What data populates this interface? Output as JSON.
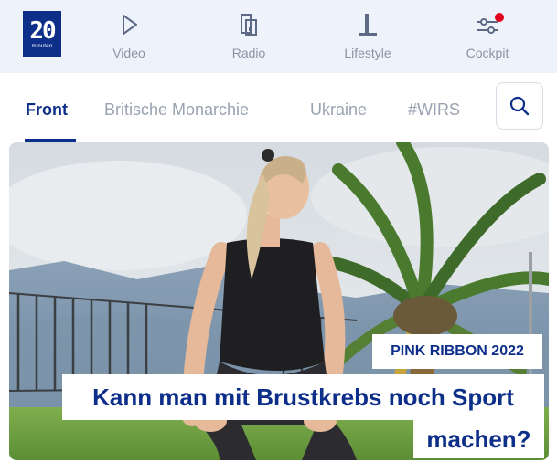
{
  "colors": {
    "brand_blue": "#0d2f8a",
    "topbar_bg": "#eef2fa",
    "muted_text": "#9aa3b2",
    "notification_red": "#e3001b"
  },
  "logo": {
    "number": "20",
    "sub": "minuten"
  },
  "nav": [
    {
      "label": "Video",
      "icon": "play-icon"
    },
    {
      "label": "Radio",
      "icon": "radio-icon"
    },
    {
      "label": "Lifestyle",
      "icon": "lifestyle-icon"
    },
    {
      "label": "Cockpit",
      "icon": "sliders-icon",
      "has_notification": true
    }
  ],
  "tabs": [
    {
      "label": "Front",
      "active": true
    },
    {
      "label": "Britische Monarchie",
      "active": false
    },
    {
      "label": "Ukraine",
      "active": false
    },
    {
      "label": "#WIRS",
      "active": false
    }
  ],
  "search": {
    "icon": "search-icon"
  },
  "hero": {
    "image": "woman-stretching-on-terrace-photo",
    "kicker": "PINK RIBBON 2022",
    "headline_line1": "Kann man mit Brustkrebs noch Sport",
    "headline_line2": "machen?"
  }
}
